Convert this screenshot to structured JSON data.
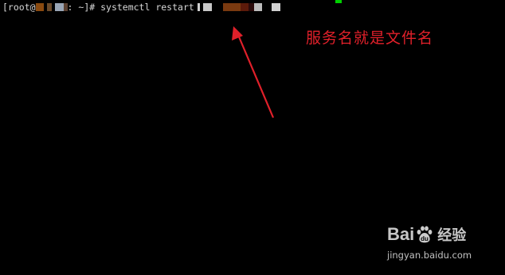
{
  "terminal": {
    "prompt_open": "[root@",
    "prompt_path": ": ~]# ",
    "command": "systemctl restart",
    "background": "#000000",
    "text_color": "#d7d7d7",
    "cursor_color": "#00d000"
  },
  "annotation": {
    "text": "服务名就是文件名",
    "color": "#e0202a"
  },
  "watermark": {
    "brand_latin": "Bai",
    "brand_suffix": "du",
    "brand_cn": "经验",
    "url": "jingyan.baidu.com"
  }
}
